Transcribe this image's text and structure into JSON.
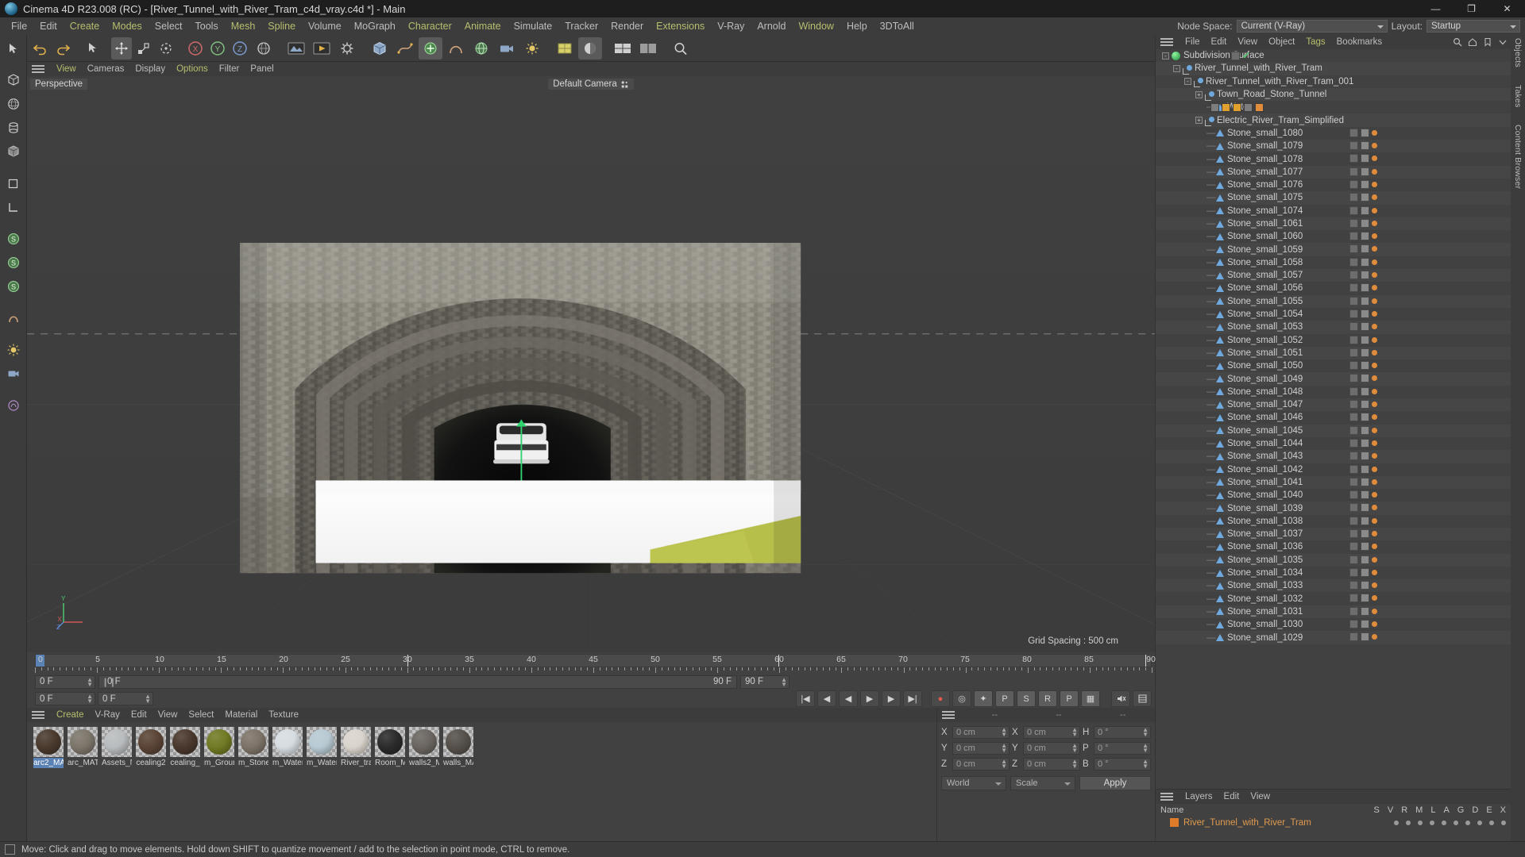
{
  "titlebar": {
    "app_icon": "c4d-logo-icon",
    "title": "Cinema 4D R23.008 (RC) - [River_Tunnel_with_River_Tram_c4d_vray.c4d *] - Main",
    "minimize": "—",
    "maximize": "❐",
    "close": "✕"
  },
  "menubar": {
    "items": [
      {
        "label": "File",
        "accent": false
      },
      {
        "label": "Edit",
        "accent": false
      },
      {
        "label": "Create",
        "accent": true
      },
      {
        "label": "Modes",
        "accent": true
      },
      {
        "label": "Select",
        "accent": false
      },
      {
        "label": "Tools",
        "accent": false
      },
      {
        "label": "Mesh",
        "accent": true
      },
      {
        "label": "Spline",
        "accent": true
      },
      {
        "label": "Volume",
        "accent": false
      },
      {
        "label": "MoGraph",
        "accent": false
      },
      {
        "label": "Character",
        "accent": true
      },
      {
        "label": "Animate",
        "accent": true
      },
      {
        "label": "Simulate",
        "accent": false
      },
      {
        "label": "Tracker",
        "accent": false
      },
      {
        "label": "Render",
        "accent": false
      },
      {
        "label": "Extensions",
        "accent": true
      },
      {
        "label": "V-Ray",
        "accent": false
      },
      {
        "label": "Arnold",
        "accent": false
      },
      {
        "label": "Window",
        "accent": true
      },
      {
        "label": "Help",
        "accent": false
      },
      {
        "label": "3DToAll",
        "accent": false
      }
    ],
    "node_space_label": "Node Space:",
    "node_space_value": "Current (V-Ray)",
    "layout_label": "Layout:",
    "layout_value": "Startup"
  },
  "viewport": {
    "menu": [
      {
        "label": "View",
        "accent": true
      },
      {
        "label": "Cameras",
        "accent": false
      },
      {
        "label": "Display",
        "accent": false
      },
      {
        "label": "Options",
        "accent": true
      },
      {
        "label": "Filter",
        "accent": false
      },
      {
        "label": "Panel",
        "accent": false
      }
    ],
    "view_label": "Perspective",
    "camera_label": "Default Camera",
    "grid_spacing": "Grid Spacing : 500 cm",
    "axis_x": "X",
    "axis_y": "Y",
    "axis_z": "Z"
  },
  "timeline": {
    "ticks": [
      "0",
      "5",
      "10",
      "15",
      "20",
      "25",
      "30",
      "35",
      "40",
      "45",
      "50",
      "55",
      "60",
      "65",
      "70",
      "75",
      "80",
      "85",
      "90"
    ],
    "current_frame_left": "0 F",
    "range_start": "0 F",
    "range_end": "90 F",
    "end_frame_field": "90 F",
    "preview_end": "90 F",
    "controls": [
      {
        "name": "goto-start-button",
        "glyph": "|◀"
      },
      {
        "name": "prev-keyframe-button",
        "glyph": "◀"
      },
      {
        "name": "play-back-button",
        "glyph": "◀"
      },
      {
        "name": "play-forward-button",
        "glyph": "▶"
      },
      {
        "name": "next-keyframe-button",
        "glyph": "▶"
      },
      {
        "name": "goto-end-button",
        "glyph": "▶|"
      },
      {
        "name": "record-active-objects-button",
        "glyph": "●"
      },
      {
        "name": "autokeying-button",
        "glyph": "◎"
      },
      {
        "name": "keyframe-selection-button",
        "glyph": "✦"
      },
      {
        "name": "position-key-button",
        "glyph": "P"
      },
      {
        "name": "scale-key-button",
        "glyph": "S"
      },
      {
        "name": "rotation-key-button",
        "glyph": "R"
      },
      {
        "name": "param-key-button",
        "glyph": "P"
      },
      {
        "name": "pla-key-button",
        "glyph": "▦"
      }
    ]
  },
  "materials": {
    "menu": [
      {
        "label": "Create",
        "accent": true
      },
      {
        "label": "V-Ray",
        "accent": false
      },
      {
        "label": "Edit",
        "accent": false
      },
      {
        "label": "View",
        "accent": false
      },
      {
        "label": "Select",
        "accent": false
      },
      {
        "label": "Material",
        "accent": false
      },
      {
        "label": "Texture",
        "accent": false
      }
    ],
    "items": [
      {
        "name": "arc2_MA",
        "color": "#4a3a2e",
        "selected": true
      },
      {
        "name": "arc_MAT",
        "color": "#7c756a",
        "selected": false
      },
      {
        "name": "Assets_N",
        "color": "#b9bcbe",
        "selected": false
      },
      {
        "name": "cealing2",
        "color": "#5a4436",
        "selected": false
      },
      {
        "name": "cealing_",
        "color": "#4a382d",
        "selected": false
      },
      {
        "name": "m_Grour",
        "color": "#717a24",
        "selected": false
      },
      {
        "name": "m_Stone",
        "color": "#7d7368",
        "selected": false
      },
      {
        "name": "m_Water",
        "color": "#d6dde2",
        "selected": false
      },
      {
        "name": "m_Water",
        "color": "#b7c9d2",
        "selected": false
      },
      {
        "name": "River_tra",
        "color": "#d9d4cb",
        "selected": false
      },
      {
        "name": "Room_M",
        "color": "#2b2b2b",
        "selected": false
      },
      {
        "name": "walls2_M",
        "color": "#6a6560",
        "selected": false
      },
      {
        "name": "walls_MA",
        "color": "#55504a",
        "selected": false
      }
    ]
  },
  "coordinates": {
    "header_dashes": [
      "--",
      "--",
      "--"
    ],
    "rows": [
      {
        "axis": "X",
        "position": "0 cm",
        "axis2": "X",
        "size": "0 cm",
        "axis3": "H",
        "rotation": "0 °"
      },
      {
        "axis": "Y",
        "position": "0 cm",
        "axis2": "Y",
        "size": "0 cm",
        "axis3": "P",
        "rotation": "0 °"
      },
      {
        "axis": "Z",
        "position": "0 cm",
        "axis2": "Z",
        "size": "0 cm",
        "axis3": "B",
        "rotation": "0 °"
      }
    ],
    "system": "World",
    "mode": "Scale",
    "apply": "Apply"
  },
  "object_manager": {
    "menu": [
      {
        "label": "File",
        "accent": false
      },
      {
        "label": "Edit",
        "accent": false
      },
      {
        "label": "View",
        "accent": false
      },
      {
        "label": "Object",
        "accent": false
      },
      {
        "label": "Tags",
        "accent": true
      },
      {
        "label": "Bookmarks",
        "accent": false
      }
    ],
    "items": [
      {
        "label": "Subdivision Surface",
        "depth": 0,
        "icon": "subdivision-surface-icon",
        "expander": "-",
        "tags": "checks"
      },
      {
        "label": "River_Tunnel_with_River_Tram",
        "depth": 1,
        "icon": "null-object-icon",
        "expander": "-",
        "tags": "orange"
      },
      {
        "label": "River_Tunnel_with_River_Tram_001",
        "depth": 2,
        "icon": "null-object-icon",
        "expander": "-",
        "tags": "orange"
      },
      {
        "label": "Town_Road_Stone_Tunnel",
        "depth": 3,
        "icon": "null-object-icon",
        "expander": "+",
        "tags": "orange"
      },
      {
        "label": "Water",
        "depth": 4,
        "icon": "polygon-object-icon",
        "expander": "",
        "tags": "vray"
      },
      {
        "label": "Electric_River_Tram_Simplified",
        "depth": 3,
        "icon": "null-object-icon",
        "expander": "+",
        "tags": "orange"
      },
      {
        "label": "Stone_small_1080",
        "depth": 4,
        "icon": "polygon-object-icon",
        "expander": "",
        "tags": "mat"
      },
      {
        "label": "Stone_small_1079",
        "depth": 4,
        "icon": "polygon-object-icon",
        "expander": "",
        "tags": "mat"
      },
      {
        "label": "Stone_small_1078",
        "depth": 4,
        "icon": "polygon-object-icon",
        "expander": "",
        "tags": "mat"
      },
      {
        "label": "Stone_small_1077",
        "depth": 4,
        "icon": "polygon-object-icon",
        "expander": "",
        "tags": "mat"
      },
      {
        "label": "Stone_small_1076",
        "depth": 4,
        "icon": "polygon-object-icon",
        "expander": "",
        "tags": "mat"
      },
      {
        "label": "Stone_small_1075",
        "depth": 4,
        "icon": "polygon-object-icon",
        "expander": "",
        "tags": "mat"
      },
      {
        "label": "Stone_small_1074",
        "depth": 4,
        "icon": "polygon-object-icon",
        "expander": "",
        "tags": "mat"
      },
      {
        "label": "Stone_small_1061",
        "depth": 4,
        "icon": "polygon-object-icon",
        "expander": "",
        "tags": "mat"
      },
      {
        "label": "Stone_small_1060",
        "depth": 4,
        "icon": "polygon-object-icon",
        "expander": "",
        "tags": "mat"
      },
      {
        "label": "Stone_small_1059",
        "depth": 4,
        "icon": "polygon-object-icon",
        "expander": "",
        "tags": "mat"
      },
      {
        "label": "Stone_small_1058",
        "depth": 4,
        "icon": "polygon-object-icon",
        "expander": "",
        "tags": "mat"
      },
      {
        "label": "Stone_small_1057",
        "depth": 4,
        "icon": "polygon-object-icon",
        "expander": "",
        "tags": "mat"
      },
      {
        "label": "Stone_small_1056",
        "depth": 4,
        "icon": "polygon-object-icon",
        "expander": "",
        "tags": "mat"
      },
      {
        "label": "Stone_small_1055",
        "depth": 4,
        "icon": "polygon-object-icon",
        "expander": "",
        "tags": "mat"
      },
      {
        "label": "Stone_small_1054",
        "depth": 4,
        "icon": "polygon-object-icon",
        "expander": "",
        "tags": "mat"
      },
      {
        "label": "Stone_small_1053",
        "depth": 4,
        "icon": "polygon-object-icon",
        "expander": "",
        "tags": "mat"
      },
      {
        "label": "Stone_small_1052",
        "depth": 4,
        "icon": "polygon-object-icon",
        "expander": "",
        "tags": "mat"
      },
      {
        "label": "Stone_small_1051",
        "depth": 4,
        "icon": "polygon-object-icon",
        "expander": "",
        "tags": "mat"
      },
      {
        "label": "Stone_small_1050",
        "depth": 4,
        "icon": "polygon-object-icon",
        "expander": "",
        "tags": "mat"
      },
      {
        "label": "Stone_small_1049",
        "depth": 4,
        "icon": "polygon-object-icon",
        "expander": "",
        "tags": "mat"
      },
      {
        "label": "Stone_small_1048",
        "depth": 4,
        "icon": "polygon-object-icon",
        "expander": "",
        "tags": "mat"
      },
      {
        "label": "Stone_small_1047",
        "depth": 4,
        "icon": "polygon-object-icon",
        "expander": "",
        "tags": "mat"
      },
      {
        "label": "Stone_small_1046",
        "depth": 4,
        "icon": "polygon-object-icon",
        "expander": "",
        "tags": "mat"
      },
      {
        "label": "Stone_small_1045",
        "depth": 4,
        "icon": "polygon-object-icon",
        "expander": "",
        "tags": "mat"
      },
      {
        "label": "Stone_small_1044",
        "depth": 4,
        "icon": "polygon-object-icon",
        "expander": "",
        "tags": "mat"
      },
      {
        "label": "Stone_small_1043",
        "depth": 4,
        "icon": "polygon-object-icon",
        "expander": "",
        "tags": "mat"
      },
      {
        "label": "Stone_small_1042",
        "depth": 4,
        "icon": "polygon-object-icon",
        "expander": "",
        "tags": "mat"
      },
      {
        "label": "Stone_small_1041",
        "depth": 4,
        "icon": "polygon-object-icon",
        "expander": "",
        "tags": "mat"
      },
      {
        "label": "Stone_small_1040",
        "depth": 4,
        "icon": "polygon-object-icon",
        "expander": "",
        "tags": "mat"
      },
      {
        "label": "Stone_small_1039",
        "depth": 4,
        "icon": "polygon-object-icon",
        "expander": "",
        "tags": "mat"
      },
      {
        "label": "Stone_small_1038",
        "depth": 4,
        "icon": "polygon-object-icon",
        "expander": "",
        "tags": "mat"
      },
      {
        "label": "Stone_small_1037",
        "depth": 4,
        "icon": "polygon-object-icon",
        "expander": "",
        "tags": "mat"
      },
      {
        "label": "Stone_small_1036",
        "depth": 4,
        "icon": "polygon-object-icon",
        "expander": "",
        "tags": "mat"
      },
      {
        "label": "Stone_small_1035",
        "depth": 4,
        "icon": "polygon-object-icon",
        "expander": "",
        "tags": "mat"
      },
      {
        "label": "Stone_small_1034",
        "depth": 4,
        "icon": "polygon-object-icon",
        "expander": "",
        "tags": "mat"
      },
      {
        "label": "Stone_small_1033",
        "depth": 4,
        "icon": "polygon-object-icon",
        "expander": "",
        "tags": "mat"
      },
      {
        "label": "Stone_small_1032",
        "depth": 4,
        "icon": "polygon-object-icon",
        "expander": "",
        "tags": "mat"
      },
      {
        "label": "Stone_small_1031",
        "depth": 4,
        "icon": "polygon-object-icon",
        "expander": "",
        "tags": "mat"
      },
      {
        "label": "Stone_small_1030",
        "depth": 4,
        "icon": "polygon-object-icon",
        "expander": "",
        "tags": "mat"
      },
      {
        "label": "Stone_small_1029",
        "depth": 4,
        "icon": "polygon-object-icon",
        "expander": "",
        "tags": "mat"
      }
    ]
  },
  "layers": {
    "menu": [
      {
        "label": "Layers",
        "accent": false
      },
      {
        "label": "Edit",
        "accent": false
      },
      {
        "label": "View",
        "accent": false
      }
    ],
    "column_name": "Name",
    "columns": [
      "S",
      "V",
      "R",
      "M",
      "L",
      "A",
      "G",
      "D",
      "E",
      "X"
    ],
    "rows": [
      {
        "label": "River_Tunnel_with_River_Tram",
        "color": "#e07b2a"
      }
    ]
  },
  "right_tabs": [
    "Objects",
    "Takes",
    "Content Browser"
  ],
  "statusbar": {
    "message": "Move: Click and drag to move elements. Hold down SHIFT to quantize movement / add to the selection in point mode, CTRL to remove."
  }
}
